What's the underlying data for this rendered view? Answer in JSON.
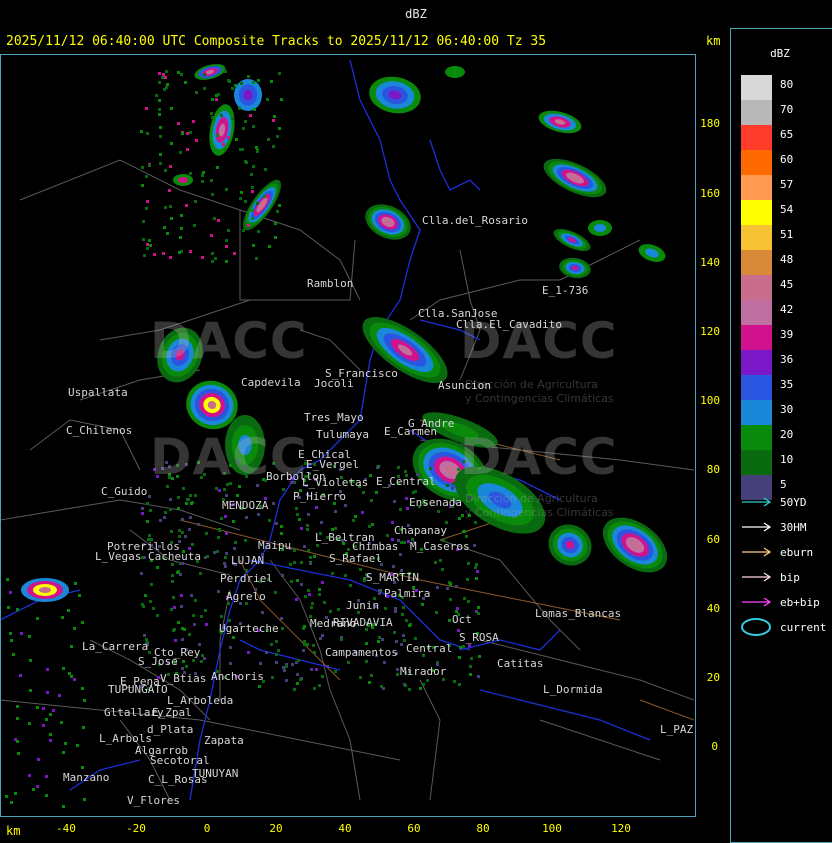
{
  "title_bar": "dBZ",
  "header": "2025/11/12 06:40:00 UTC Composite Tracks to 2025/11/12 06:40:00 Tz 35",
  "unit_km": "km",
  "legend": {
    "title": "dBZ",
    "levels": [
      {
        "label": "80",
        "color": "#d8d8d8"
      },
      {
        "label": "70",
        "color": "#b8b8b8"
      },
      {
        "label": "65",
        "color": "#ff3b2a"
      },
      {
        "label": "60",
        "color": "#ff6a00"
      },
      {
        "label": "57",
        "color": "#ff9a50"
      },
      {
        "label": "54",
        "color": "#ffff00"
      },
      {
        "label": "51",
        "color": "#f7c233"
      },
      {
        "label": "48",
        "color": "#d88a38"
      },
      {
        "label": "45",
        "color": "#c86d8c"
      },
      {
        "label": "42",
        "color": "#c070a0"
      },
      {
        "label": "39",
        "color": "#d0138c"
      },
      {
        "label": "36",
        "color": "#7a18c8"
      },
      {
        "label": "35",
        "color": "#2a55e0"
      },
      {
        "label": "30",
        "color": "#1a88d8"
      },
      {
        "label": "20",
        "color": "#0a8a0a"
      },
      {
        "label": "10",
        "color": "#0a6a10"
      },
      {
        "label": "5",
        "color": "#46407a"
      }
    ],
    "tracks": [
      {
        "label": "50YD",
        "color": "#33cccc"
      },
      {
        "label": "30HM",
        "color": "#ffffff"
      },
      {
        "label": "eburn",
        "color": "#ffcc88"
      },
      {
        "label": "bip",
        "color": "#ffd8e8"
      },
      {
        "label": "eb+bip",
        "color": "#ff44ff"
      },
      {
        "label": "current",
        "color": "#33ccdd"
      }
    ]
  },
  "axes": {
    "x_ticks": [
      "-40",
      "-20",
      "0",
      "20",
      "40",
      "60",
      "80",
      "100",
      "120"
    ],
    "y_ticks": [
      "180",
      "160",
      "140",
      "120",
      "100",
      "80",
      "60",
      "40",
      "20",
      "0"
    ]
  },
  "watermark": {
    "brand": "DACC",
    "line1": "Dirección de Agricultura",
    "line2": "y Contingencias Climáticas"
  },
  "places": [
    {
      "name": "Clla.del_Rosario"
    },
    {
      "name": "Ramblon"
    },
    {
      "name": "Clla.SanJose"
    },
    {
      "name": "Clla.El_Cavadito"
    },
    {
      "name": "Asuncion"
    },
    {
      "name": "E_1-736"
    },
    {
      "name": "Uspallata"
    },
    {
      "name": "Capdevila"
    },
    {
      "name": "S_Francisco"
    },
    {
      "name": "Jocoli"
    },
    {
      "name": "Tres_Mayo"
    },
    {
      "name": "Tulumaya"
    },
    {
      "name": "G_Andre"
    },
    {
      "name": "E_Carmen"
    },
    {
      "name": "C_Chilenos"
    },
    {
      "name": "E_Chical"
    },
    {
      "name": "E_Vergel"
    },
    {
      "name": "Borbollon"
    },
    {
      "name": "L_Violetas"
    },
    {
      "name": "E_Central"
    },
    {
      "name": "C_Guido"
    },
    {
      "name": "P_Hierro"
    },
    {
      "name": "MENDOZA"
    },
    {
      "name": "Chapanay"
    },
    {
      "name": "Potrerillos"
    },
    {
      "name": "Cacheuta"
    },
    {
      "name": "L_Vegas"
    },
    {
      "name": "L_Beltran"
    },
    {
      "name": "S_MARTIN"
    },
    {
      "name": "Perdriel"
    },
    {
      "name": "Agrelo"
    },
    {
      "name": "Ugarteche"
    },
    {
      "name": "La_Carrera"
    },
    {
      "name": "Cto_Rey"
    },
    {
      "name": "S_Jose"
    },
    {
      "name": "E_Pena"
    },
    {
      "name": "V_Btias"
    },
    {
      "name": "Anchoris"
    },
    {
      "name": "TUPUNGATO"
    },
    {
      "name": "L_Arboleda"
    },
    {
      "name": "Gltallary"
    },
    {
      "name": "E_Zpal"
    },
    {
      "name": "d_Plata"
    },
    {
      "name": "L_Arbols"
    },
    {
      "name": "Zapata"
    },
    {
      "name": "Algarrob"
    },
    {
      "name": "Secotoral"
    },
    {
      "name": "TUNUYAN"
    },
    {
      "name": "Manzano"
    },
    {
      "name": "C_L_Rosas"
    },
    {
      "name": "V_Flores"
    },
    {
      "name": "Lomas_Blancas"
    },
    {
      "name": "S_ROSA"
    },
    {
      "name": "Catitas"
    },
    {
      "name": "Central"
    },
    {
      "name": "Mirador"
    },
    {
      "name": "L_Dormida"
    },
    {
      "name": "L_PAZ"
    },
    {
      "name": "Campamentos"
    },
    {
      "name": "M_Caseros"
    },
    {
      "name": "Chimbas"
    },
    {
      "name": "RIVADAVIA"
    },
    {
      "name": "Palmira"
    },
    {
      "name": "Medrano"
    },
    {
      "name": "Junin"
    },
    {
      "name": "Oct"
    },
    {
      "name": "LUJAN"
    },
    {
      "name": "Maipu"
    },
    {
      "name": "S_Rafael"
    },
    {
      "name": "Ensenada"
    }
  ]
}
